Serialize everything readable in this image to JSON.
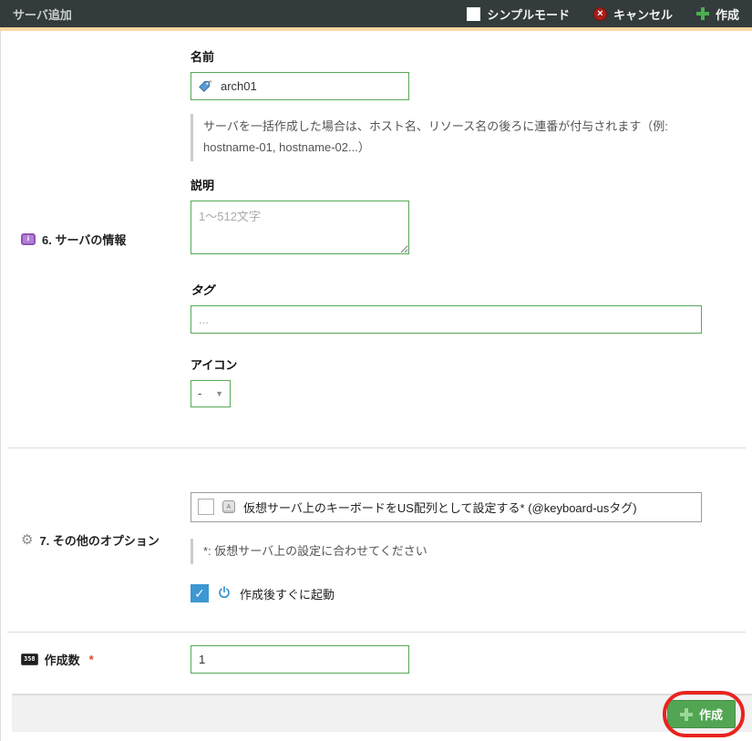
{
  "header": {
    "title": "サーバ追加",
    "simple_mode_label": "シンプルモード",
    "cancel_label": "キャンセル",
    "create_label": "作成"
  },
  "sections": {
    "server_info": {
      "label": "6. サーバの情報",
      "name": {
        "label": "名前",
        "value": "arch01"
      },
      "name_help": "サーバを一括作成した場合は、ホスト名、リソース名の後ろに連番が付与されます（例: hostname-01, hostname-02...）",
      "description": {
        "label": "説明",
        "placeholder": "1〜512文字"
      },
      "tags": {
        "label": "タグ",
        "placeholder": "..."
      },
      "icon": {
        "label": "アイコン",
        "value": "-"
      }
    },
    "other_options": {
      "label": "7. その他のオプション",
      "keyboard_us": {
        "label": "仮想サーバ上のキーボードをUS配列として設定する* (@keyboard-usタグ)",
        "checked": false
      },
      "note": "*: 仮想サーバ上の設定に合わせてください",
      "boot_after_create": {
        "label": "作成後すぐに起動",
        "checked": true
      }
    },
    "create_count": {
      "label": "作成数",
      "required_mark": "*",
      "value": "1"
    }
  },
  "footer": {
    "create_label": "作成"
  },
  "glyphs": {
    "gear": "⚙",
    "check": "✓",
    "dropdown_arrow": "▼",
    "cancel_x": "×",
    "info_i": "i",
    "keyboard_key_letter": "A",
    "counter_digits": "358"
  },
  "icons": {
    "header_cancel": "x-circle-red",
    "header_create": "green-plus",
    "section_server_info": "purple-info-card",
    "section_other_options": "gear",
    "name_field": "blue-tag",
    "keyboard_option": "keyboard-key",
    "boot_option": "power",
    "create_count": "numeric-counter",
    "footer_create": "green-plus",
    "annotation": "red-highlight-ellipse"
  },
  "colors": {
    "header_bg": "#343b3c",
    "accent_bar": "#fbd9a2",
    "input_border": "#57a957",
    "create_button": "#52a552",
    "cancel_red": "#a8201a",
    "checked_blue": "#3d97d3",
    "annotation_red": "#e8241f"
  }
}
